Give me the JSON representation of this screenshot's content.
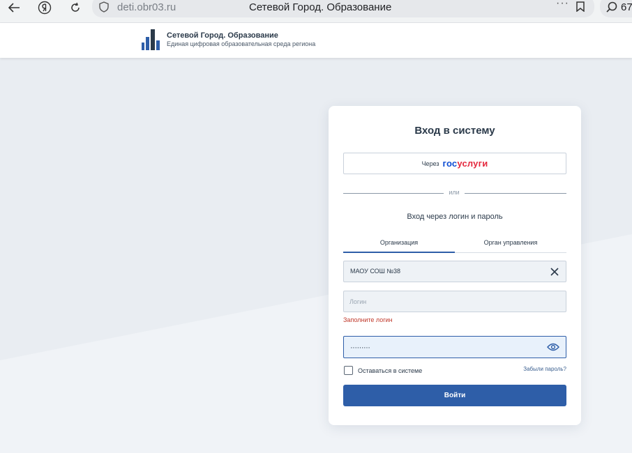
{
  "browser": {
    "url": "deti.obr03.ru",
    "tab_title": "Сетевой Город. Образование",
    "extension_count": "67"
  },
  "header": {
    "brand_title": "Сетевой Город. Образование",
    "brand_subtitle": "Единая цифровая образовательная среда региона"
  },
  "login_card": {
    "title": "Вход в систему",
    "gosuslugi_prefix": "Через",
    "gosuslugi_logo_part1": "гос",
    "gosuslugi_logo_part2": "услуги",
    "divider_text": "или",
    "caption": "Вход через логин и пароль",
    "tabs": [
      {
        "label": "Организация",
        "active": true
      },
      {
        "label": "Орган управления",
        "active": false
      }
    ],
    "organization_value": "МАОУ СОШ №38",
    "login_placeholder": "Логин",
    "login_value": "",
    "login_error": "Заполните логин",
    "password_value": "·········",
    "remember_label": "Оставаться в системе",
    "remember_checked": false,
    "forgot_label": "Забыли пароль?",
    "submit_label": "Войти"
  },
  "colors": {
    "accent": "#2e5ea8",
    "error": "#c0392b",
    "gosuslugi_blue": "#0d4cd3",
    "gosuslugi_red": "#e4283d"
  }
}
